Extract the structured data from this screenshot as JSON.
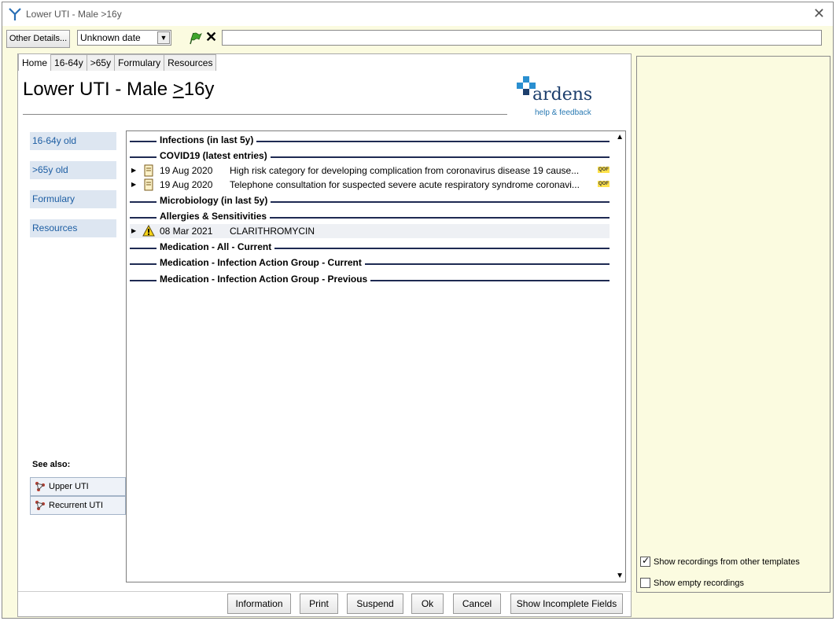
{
  "window": {
    "title": "Lower UTI - Male >16y",
    "close": "✕"
  },
  "toolbar": {
    "other_details": "Other Details...",
    "date_value": "Unknown date",
    "free_text": ""
  },
  "tabs": [
    "Home",
    "16-64y",
    ">65y",
    "Formulary",
    "Resources"
  ],
  "page": {
    "title_prefix": "Lower UTI - Male ",
    "title_ge": ">",
    "title_suffix": "16y"
  },
  "logo": {
    "word": "ardens",
    "sub": "help & feedback"
  },
  "side_nav": [
    "16-64y old",
    ">65y old",
    "Formulary",
    "Resources"
  ],
  "see_also": {
    "heading": "See also:",
    "items": [
      "Upper UTI",
      "Recurrent UTI"
    ]
  },
  "sections": [
    "Infections (in last 5y)",
    "COVID19 (latest entries)",
    "Microbiology (in last 5y)",
    "Allergies & Sensitivities",
    "Medication - All - Current",
    "Medication - Infection Action Group - Current",
    "Medication - Infection Action Group - Previous"
  ],
  "covid_rows": [
    {
      "date": "19 Aug 2020",
      "desc": "High risk category for developing complication from coronavirus disease 19 cause...",
      "badge": "QOF"
    },
    {
      "date": "19 Aug 2020",
      "desc": "Telephone consultation for suspected severe acute respiratory syndrome coronavi...",
      "badge": "QOF"
    }
  ],
  "allergy_rows": [
    {
      "date": "08 Mar 2021",
      "desc": "CLARITHROMYCIN"
    }
  ],
  "buttons": {
    "information": "Information",
    "print": "Print",
    "suspend": "Suspend",
    "ok": "Ok",
    "cancel": "Cancel",
    "show_incomplete": "Show Incomplete Fields"
  },
  "right_panel": {
    "show_other_templates": "Show recordings from other templates",
    "show_other_templates_checked": true,
    "show_empty": "Show empty recordings",
    "show_empty_checked": false
  },
  "colors": {
    "panel_bg": "#fbfbe0",
    "nav_bg": "#dde6f1",
    "nav_text": "#1d5ea3",
    "section_line": "#1e2a52",
    "brand_blue": "#2a8fd0"
  }
}
